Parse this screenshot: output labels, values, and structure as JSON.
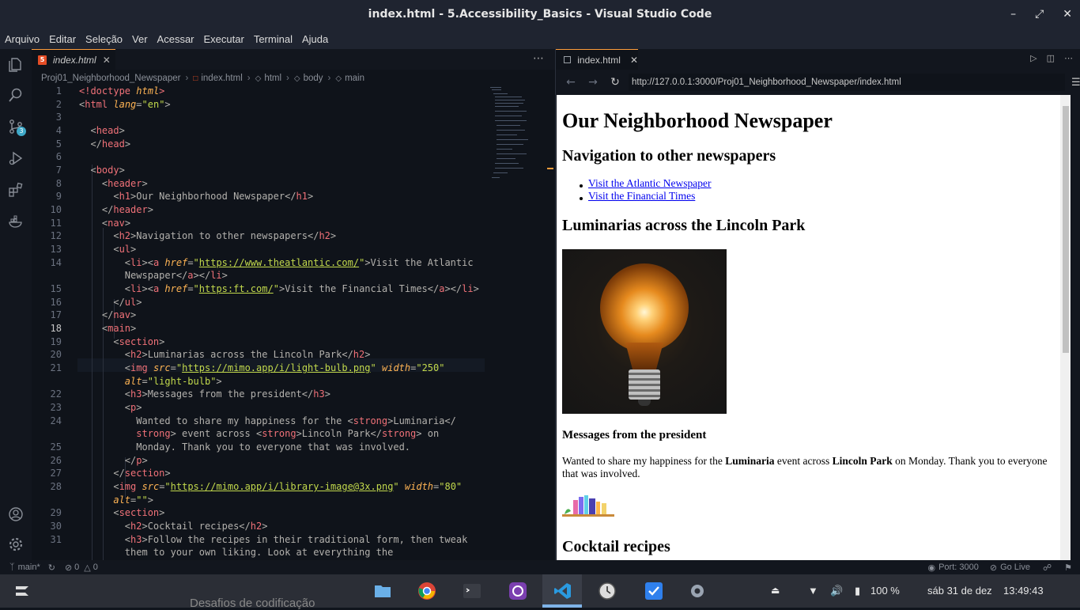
{
  "window": {
    "title": "index.html - 5.Accessibility_Basics - Visual Studio Code"
  },
  "menu": [
    "Arquivo",
    "Editar",
    "Seleção",
    "Ver",
    "Acessar",
    "Executar",
    "Terminal",
    "Ajuda"
  ],
  "activity_badge": "3",
  "editor": {
    "tab_label": "index.html",
    "breadcrumb": [
      "Proj01_Neighborhood_Newspaper",
      "index.html",
      "html",
      "body",
      "main"
    ],
    "line_numbers": [
      "1",
      "2",
      "3",
      "4",
      "5",
      "6",
      "7",
      "8",
      "9",
      "10",
      "11",
      "12",
      "13",
      "14",
      "",
      "15",
      "16",
      "17",
      "18",
      "19",
      "20",
      "21",
      "",
      "22",
      "23",
      "24",
      "",
      "25",
      "26",
      "27",
      "28",
      "",
      "29",
      "30",
      "31",
      ""
    ],
    "current_line": "18"
  },
  "preview": {
    "tab_label": "index.html",
    "url": "http://127.0.0.1:3000/Proj01_Neighborhood_Newspaper/index.html",
    "h1": "Our Neighborhood Newspaper",
    "nav_heading": "Navigation to other newspapers",
    "links": [
      "Visit the Atlantic Newspaper",
      "Visit the Financial Times"
    ],
    "section_heading": "Luminarias across the Lincoln Park",
    "h3": "Messages from the president",
    "para_pre": "Wanted to share my happiness for the ",
    "para_strong1": "Luminaria",
    "para_mid": " event across ",
    "para_strong2": "Lincoln Park",
    "para_post": " on Monday. Thank you to everyone that was involved.",
    "cocktail_heading": "Cocktail recipes"
  },
  "status": {
    "branch": "main*",
    "errors": "0",
    "warnings": "0",
    "port": "Port: 3000",
    "golive": "Go Live"
  },
  "taskbar": {
    "behind_text": "Desafios de codificação",
    "battery": "100 %",
    "date": "sáb 31 de dez",
    "time": "13:49:43"
  },
  "colors": {
    "accent": "#ff9e3b",
    "link": "#0000ee",
    "tag": "#39bae6",
    "string": "#c2d94c"
  }
}
